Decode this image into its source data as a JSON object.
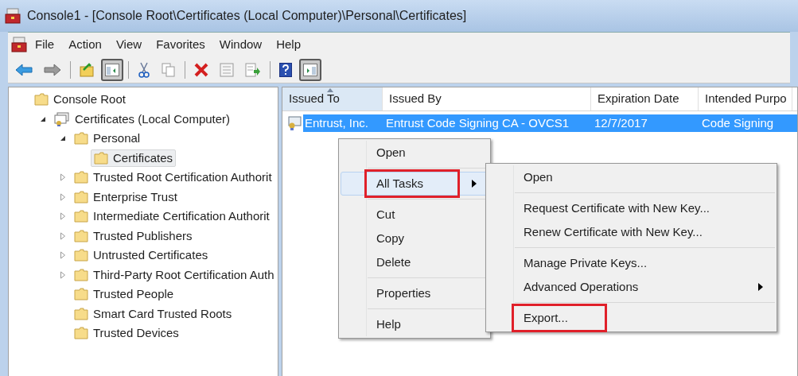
{
  "window": {
    "title": "Console1 - [Console Root\\Certificates (Local Computer)\\Personal\\Certificates]"
  },
  "menu_bar": [
    "File",
    "Action",
    "View",
    "Favorites",
    "Window",
    "Help"
  ],
  "toolbar": [
    {
      "kind": "back",
      "pressed": false
    },
    {
      "kind": "forward",
      "pressed": false
    },
    {
      "kind": "sep"
    },
    {
      "kind": "up",
      "pressed": false
    },
    {
      "kind": "tree",
      "pressed": true
    },
    {
      "kind": "sep"
    },
    {
      "kind": "cut",
      "pressed": false
    },
    {
      "kind": "copy",
      "pressed": false
    },
    {
      "kind": "sep"
    },
    {
      "kind": "delete",
      "pressed": false
    },
    {
      "kind": "properties",
      "pressed": false
    },
    {
      "kind": "export",
      "pressed": false
    },
    {
      "kind": "sep"
    },
    {
      "kind": "help",
      "pressed": false
    },
    {
      "kind": "actionpane",
      "pressed": true
    }
  ],
  "tree": [
    {
      "label": "Console Root",
      "kind": "folder",
      "expandable": false,
      "selected": false,
      "children": [
        {
          "label": "Certificates (Local Computer)",
          "kind": "snapin",
          "expandable": true,
          "expanded": true,
          "selected": false,
          "children": [
            {
              "label": "Personal",
              "kind": "folder",
              "expandable": true,
              "expanded": true,
              "selected": false,
              "children": [
                {
                  "label": "Certificates",
                  "kind": "folder",
                  "expandable": false,
                  "expanded": false,
                  "selected": true
                }
              ]
            },
            {
              "label": "Trusted Root Certification Authorit",
              "kind": "folder",
              "expandable": true,
              "expanded": false,
              "selected": false
            },
            {
              "label": "Enterprise Trust",
              "kind": "folder",
              "expandable": true,
              "expanded": false,
              "selected": false
            },
            {
              "label": "Intermediate Certification Authorit",
              "kind": "folder",
              "expandable": true,
              "expanded": false,
              "selected": false
            },
            {
              "label": "Trusted Publishers",
              "kind": "folder",
              "expandable": true,
              "expanded": false,
              "selected": false
            },
            {
              "label": "Untrusted Certificates",
              "kind": "folder",
              "expandable": true,
              "expanded": false,
              "selected": false
            },
            {
              "label": "Third-Party Root Certification Auth",
              "kind": "folder",
              "expandable": true,
              "expanded": false,
              "selected": false
            },
            {
              "label": "Trusted People",
              "kind": "folder",
              "expandable": false,
              "expanded": false,
              "selected": false
            },
            {
              "label": "Smart Card Trusted Roots",
              "kind": "folder",
              "expandable": false,
              "expanded": false,
              "selected": false
            },
            {
              "label": "Trusted Devices",
              "kind": "folder",
              "expandable": false,
              "expanded": false,
              "selected": false
            }
          ]
        }
      ]
    }
  ],
  "table": {
    "columns": [
      {
        "label": "Issued To",
        "sorted": true
      },
      {
        "label": "Issued By",
        "sorted": false
      },
      {
        "label": "Expiration Date",
        "sorted": false
      },
      {
        "label": "Intended Purpo",
        "sorted": false
      }
    ],
    "rows": [
      {
        "cells": [
          "Entrust, Inc.",
          "Entrust Code Signing CA - OVCS1",
          "12/7/2017",
          "Code Signing"
        ],
        "selected": true
      }
    ]
  },
  "context_menu": {
    "items": [
      {
        "kind": "item",
        "label": "Open",
        "submenu": false,
        "hovered": false,
        "highlighted": false
      },
      {
        "kind": "separator"
      },
      {
        "kind": "item",
        "label": "All Tasks",
        "submenu": true,
        "hovered": true,
        "highlighted": true
      },
      {
        "kind": "separator"
      },
      {
        "kind": "item",
        "label": "Cut",
        "submenu": false,
        "hovered": false,
        "highlighted": false
      },
      {
        "kind": "item",
        "label": "Copy",
        "submenu": false,
        "hovered": false,
        "highlighted": false
      },
      {
        "kind": "item",
        "label": "Delete",
        "submenu": false,
        "hovered": false,
        "highlighted": false
      },
      {
        "kind": "separator"
      },
      {
        "kind": "item",
        "label": "Properties",
        "submenu": false,
        "hovered": false,
        "highlighted": false
      },
      {
        "kind": "separator"
      },
      {
        "kind": "item",
        "label": "Help",
        "submenu": false,
        "hovered": false,
        "highlighted": false
      }
    ]
  },
  "submenu": {
    "items": [
      {
        "kind": "item",
        "label": "Open",
        "submenu": false,
        "hovered": false,
        "highlighted": false
      },
      {
        "kind": "separator"
      },
      {
        "kind": "item",
        "label": "Request Certificate with New Key...",
        "submenu": false,
        "hovered": false,
        "highlighted": false
      },
      {
        "kind": "item",
        "label": "Renew Certificate with New Key...",
        "submenu": false,
        "hovered": false,
        "highlighted": false
      },
      {
        "kind": "separator"
      },
      {
        "kind": "item",
        "label": "Manage Private Keys...",
        "submenu": false,
        "hovered": false,
        "highlighted": false
      },
      {
        "kind": "item",
        "label": "Advanced Operations",
        "submenu": true,
        "hovered": false,
        "highlighted": false
      },
      {
        "kind": "separator"
      },
      {
        "kind": "item",
        "label": "Export...",
        "submenu": false,
        "hovered": false,
        "highlighted": true
      }
    ]
  }
}
